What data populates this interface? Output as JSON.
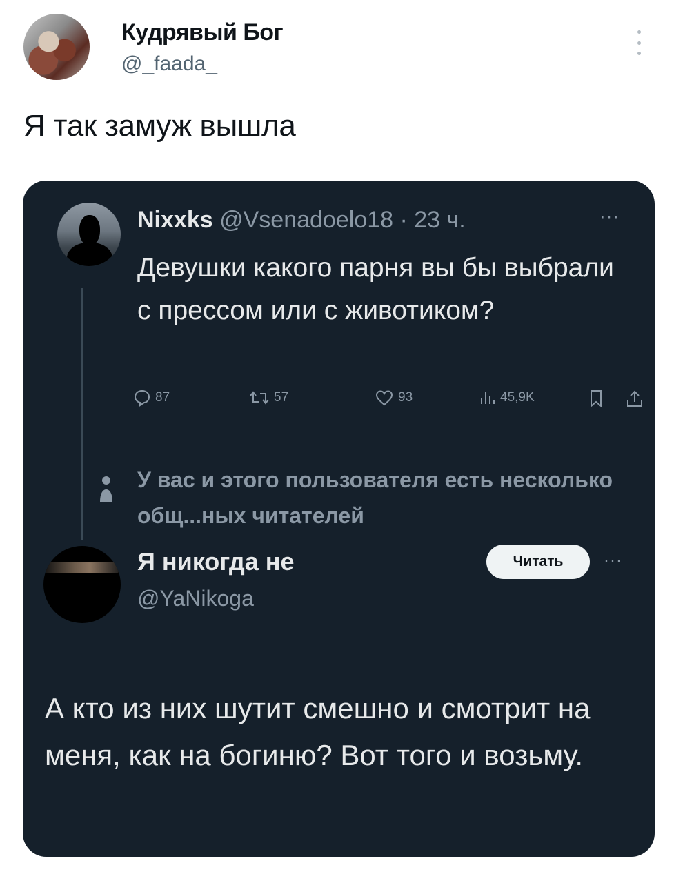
{
  "tweet": {
    "author_name": "Кудрявый Бог",
    "author_handle": "@_faada_",
    "text": "Я так замуж вышла"
  },
  "quoted_screenshot": {
    "colors": {
      "background": "#15202b",
      "text": "#e7e9ea",
      "muted": "#8b98a5",
      "button_bg": "#eff3f4"
    },
    "first_post": {
      "name": "Nixxks",
      "handle_time": " @Vsenadoelo18 · 23 ч.",
      "text": "Девушки какого парня вы бы выбрали с прессом или с животиком?",
      "more": "···",
      "metrics": {
        "replies": "87",
        "reposts": "57",
        "likes": "93",
        "views": "45,9K"
      }
    },
    "social_context": "У вас и этого пользователя есть несколько общ...ных читателей",
    "second_post": {
      "name": "Я никогда не",
      "handle": "@YaNikoga",
      "follow_label": "Читать",
      "more": "···",
      "text": "А кто из них шутит смешно и смотрит на меня, как на богиню? Вот того и возьму."
    }
  }
}
